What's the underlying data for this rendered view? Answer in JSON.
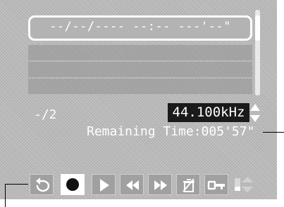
{
  "recording": {
    "timestamp": "--/--/---- --:-- ---'--\"",
    "page_counter": "-/2",
    "sample_rate": "44.100kHz",
    "remaining_time": "Remaining Time:005'57\""
  },
  "toolbar": {
    "buttons": [
      {
        "icon": "return-icon"
      },
      {
        "icon": "record-icon",
        "selected": true
      },
      {
        "icon": "play-icon"
      },
      {
        "icon": "rewind-icon"
      },
      {
        "icon": "fast-forward-icon"
      },
      {
        "icon": "erase-icon"
      },
      {
        "icon": "protect-key-icon"
      },
      {
        "icon": "volume-icon"
      }
    ]
  }
}
